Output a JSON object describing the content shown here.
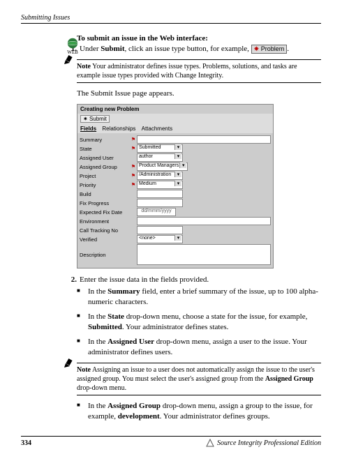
{
  "header": "Submitting Issues",
  "webIconLabel": "WEB",
  "headline": "To submit an issue in the Web interface:",
  "step1_num": "1.",
  "step1_a": "Under ",
  "step1_submit": "Submit",
  "step1_b": ", click an issue type button, for example, ",
  "problemBtn": "Problem",
  "note1_label": "Note",
  "note1_body": "  Your administrator defines issue types. Problems, solutions, and tasks are example issue types provided with Change Integrity.",
  "appears": "The Submit Issue page appears.",
  "form": {
    "title": "Creating new Problem",
    "submit": "Submit",
    "tabs": [
      "Fields",
      "Relationships",
      "Attachments"
    ],
    "rows": {
      "summary": "Summary",
      "state": "State",
      "state_val": "Submitted",
      "assignedUser": "Assigned User",
      "assignedUser_val": "author",
      "assignedGroup": "Assigned Group",
      "assignedGroup_val": "Product Managers",
      "project": "Project",
      "project_val": "/Administration",
      "priority": "Priority",
      "priority_val": "Medium",
      "build": "Build",
      "fixProgress": "Fix Progress",
      "expectedFixDate": "Expected Fix Date",
      "expectedFixDate_val": "dd/mmm/yyyy",
      "environment": "Environment",
      "callTrackingNo": "Call Tracking No",
      "verified": "Verified",
      "verified_val": "<none>",
      "description": "Description"
    }
  },
  "step2_num": "2.",
  "step2_text": "Enter the issue data in the fields provided.",
  "bullets1": {
    "b1a": "In the ",
    "b1b": "Summary",
    "b1c": " field, enter a brief summary of the issue, up to 100 alpha-numeric characters.",
    "b2a": "In the ",
    "b2b": "State",
    "b2c": " drop-down menu, choose a state for the issue, for example, ",
    "b2d": "Submitted",
    "b2e": ". Your administrator defines states.",
    "b3a": "In the ",
    "b3b": "Assigned User",
    "b3c": " drop-down menu, assign a user to the issue. Your administrator defines users."
  },
  "note2_label": "Note",
  "note2_a": "  Assigning an issue to a user does not automatically assign the issue to the user's assigned group. You must select the user's assigned group from the ",
  "note2_b": "Assigned Group",
  "note2_c": " drop-down menu.",
  "bullets2": {
    "a": "In the ",
    "b": "Assigned Group",
    "c": " drop-down menu, assign a group to the issue, for example, ",
    "d": "development",
    "e": ". Your administrator defines groups."
  },
  "pageNum": "334",
  "footerTitle": "Source Integrity Professional Edition"
}
